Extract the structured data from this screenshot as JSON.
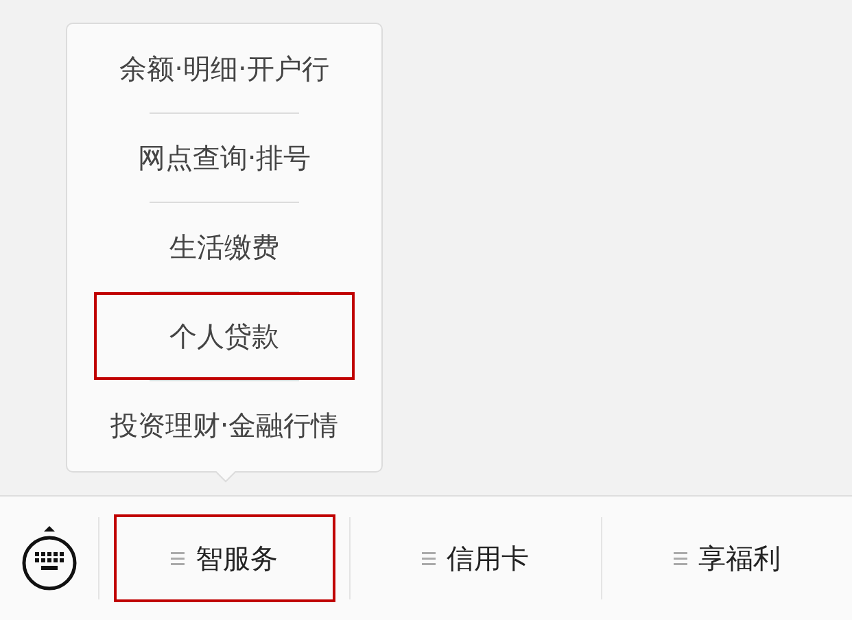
{
  "popup_menu": {
    "items": [
      {
        "label": "余额·明细·开户行",
        "highlighted": false
      },
      {
        "label": "网点查询·排号",
        "highlighted": false
      },
      {
        "label": "生活缴费",
        "highlighted": false
      },
      {
        "label": "个人贷款",
        "highlighted": true
      },
      {
        "label": "投资理财·金融行情",
        "highlighted": false
      }
    ]
  },
  "bottom_bar": {
    "tabs": [
      {
        "label": "智服务",
        "highlighted": true
      },
      {
        "label": "信用卡",
        "highlighted": false
      },
      {
        "label": "享福利",
        "highlighted": false
      }
    ]
  }
}
